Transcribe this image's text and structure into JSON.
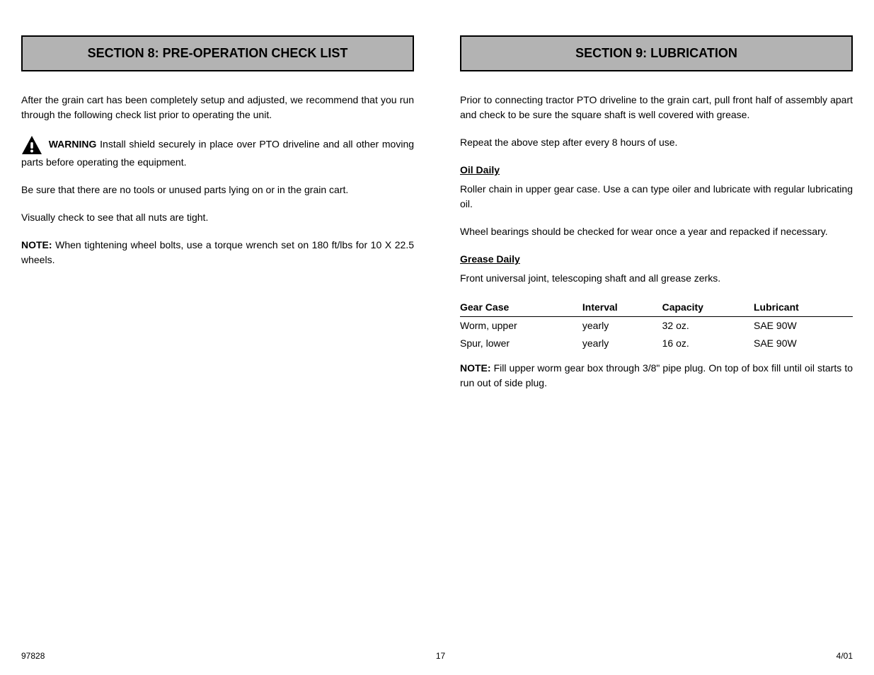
{
  "left": {
    "header": "SECTION 8: PRE-OPERATION CHECK LIST",
    "para1": "After the grain cart has been completely setup and adjusted, we recommend that you run through the following check list prior to operating the unit.",
    "warning_label": "WARNING",
    "para2_warning": "Install shield securely in place over PTO driveline and all other moving parts before operating the equipment.",
    "para3": "Be sure that there are no tools or unused parts lying on or in the grain cart.",
    "para4": "Visually check to see that all nuts are tight.",
    "para5_prefix": "",
    "note_label": "NOTE:",
    "para5_body": "When tightening wheel bolts, use a torque wrench set on 180 ft/lbs for 10 X 22.5 wheels."
  },
  "right": {
    "header": "SECTION 9: LUBRICATION",
    "para1": "Prior to connecting tractor PTO driveline to the grain cart, pull front half of assembly apart and check to be sure the square shaft is well covered with grease.",
    "para2": "Repeat the above step after every 8 hours of use.",
    "sub1": "Oil Daily",
    "para3": "Roller chain in upper gear case. Use a can type oiler and lubricate with regular lubricating oil.",
    "para4": "Wheel bearings should be checked for wear once a year and repacked if necessary.",
    "sub2": "Grease Daily",
    "para5": "Front universal joint, telescoping shaft and all grease zerks.",
    "table": {
      "headers": [
        "Gear Case",
        "Interval",
        "Capacity",
        "Lubricant"
      ],
      "rows": [
        [
          "Worm, upper",
          "yearly",
          "32 oz.",
          "SAE 90W"
        ],
        [
          "Spur, lower",
          "yearly",
          "16 oz.",
          "SAE 90W"
        ]
      ]
    },
    "para6_prefix": "",
    "note_label": "NOTE:",
    "para6_body": "Fill upper worm gear box through 3/8\" pipe plug. On top of box fill until oil starts to run out of side plug."
  },
  "footer": {
    "left": "97828",
    "center": "17",
    "right": "4/01"
  }
}
